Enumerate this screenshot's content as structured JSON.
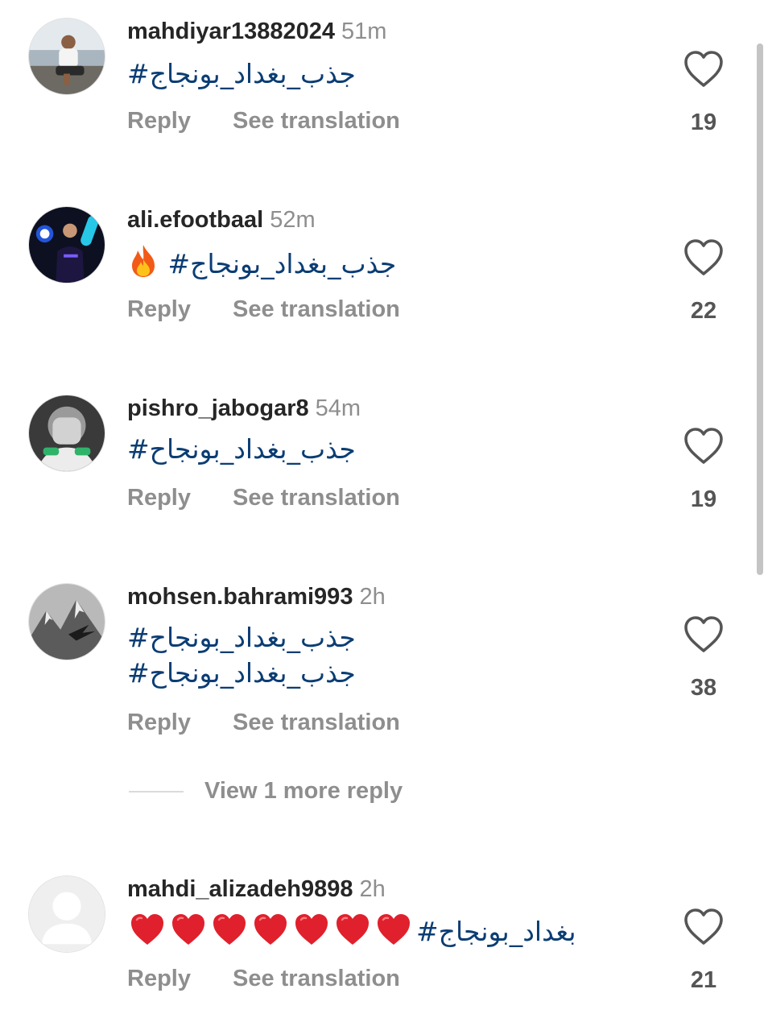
{
  "comments": [
    {
      "username": "mahdiyar13882024",
      "time": "51m",
      "text": "#جذب_بغداد_بونجاج",
      "reply": "Reply",
      "translate": "See translation",
      "likes": "19",
      "avatar": "man-sitting-avatar"
    },
    {
      "username": "ali.efootbaal",
      "time": "52m",
      "text": "#جذب_بغداد_بونجاج",
      "reply": "Reply",
      "translate": "See translation",
      "likes": "22",
      "avatar": "efootball-player-avatar",
      "emoji": "fire"
    },
    {
      "username": "pishro_jabogar8",
      "time": "54m",
      "text": "#جذب_بغداد_بونجاح",
      "reply": "Reply",
      "translate": "See translation",
      "likes": "19",
      "avatar": "face-covered-avatar"
    },
    {
      "username": "mohsen.bahrami993",
      "time": "2h",
      "text": "#جذب_بغداد_بونجاح\n#جذب_بغداد_بونجاح",
      "reply": "Reply",
      "translate": "See translation",
      "likes": "38",
      "avatar": "mountain-eagle-avatar"
    },
    {
      "username": "mahdi_alizadeh9898",
      "time": "2h",
      "text": "#بغداد_بونجاج",
      "reply": "Reply",
      "translate": "See translation",
      "likes": "21",
      "avatar": "default-avatar",
      "heart_emoji_count": 7
    }
  ],
  "view_more_replies": "View 1 more reply",
  "colors": {
    "hashtag": "#0b3d74",
    "username": "#262626",
    "muted": "#8e8e8e",
    "heart_emoji": "#e0202c"
  }
}
